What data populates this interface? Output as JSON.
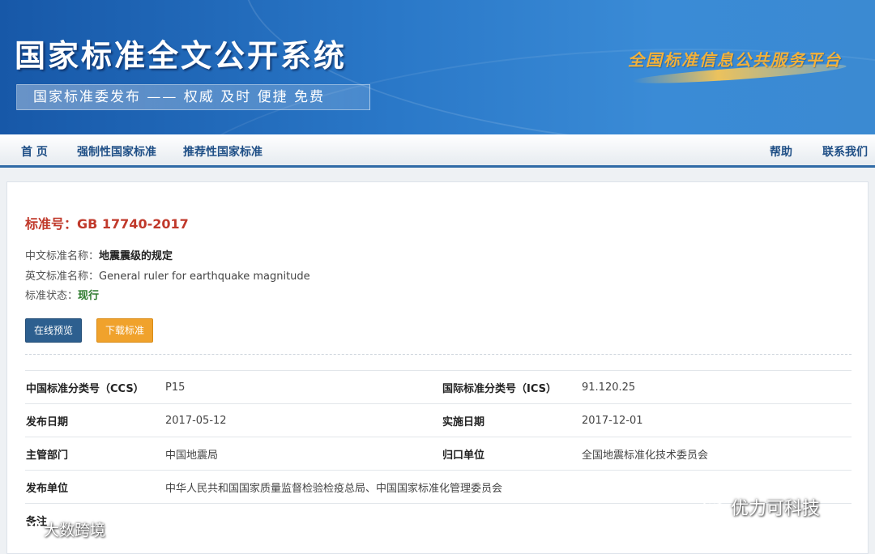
{
  "header": {
    "site_title": "国家标准全文公开系统",
    "slogan": "国家标准委发布 —— 权威 及时 便捷 免费",
    "platform": "全国标准信息公共服务平台"
  },
  "nav": {
    "home": "首 页",
    "mandatory": "强制性国家标准",
    "recommended": "推荐性国家标准",
    "help": "帮助",
    "contact": "联系我们"
  },
  "standard": {
    "number_label": "标准号：",
    "number": "GB 17740-2017",
    "cn_name_label": "中文标准名称：",
    "cn_name": "地震震级的规定",
    "en_name_label": "英文标准名称：",
    "en_name": "General ruler for earthquake magnitude",
    "status_label": "标准状态：",
    "status": "现行"
  },
  "buttons": {
    "preview": "在线预览",
    "download": "下载标准"
  },
  "meta": {
    "ccs_label": "中国标准分类号（CCS）",
    "ccs": "P15",
    "ics_label": "国际标准分类号（ICS）",
    "ics": "91.120.25",
    "publish_date_label": "发布日期",
    "publish_date": "2017-05-12",
    "impl_date_label": "实施日期",
    "impl_date": "2017-12-01",
    "dept_label": "主管部门",
    "dept": "中国地震局",
    "unit_label": "归口单位",
    "unit": "全国地震标准化技术委员会",
    "publisher_label": "发布单位",
    "publisher": "中华人民共和国国家质量监督检验检疫总局、中国国家标准化管理委员会",
    "remark_label": "备注"
  },
  "watermarks": {
    "right": "优力可科技",
    "left": "大数跨境"
  },
  "colors": {
    "banner": "#2a78c8",
    "nav_text": "#1f4f86",
    "std_number": "#c0392b",
    "preview_button": "#2d5f8f",
    "download_button": "#f0a22c",
    "status_green": "#2d7a2d"
  }
}
